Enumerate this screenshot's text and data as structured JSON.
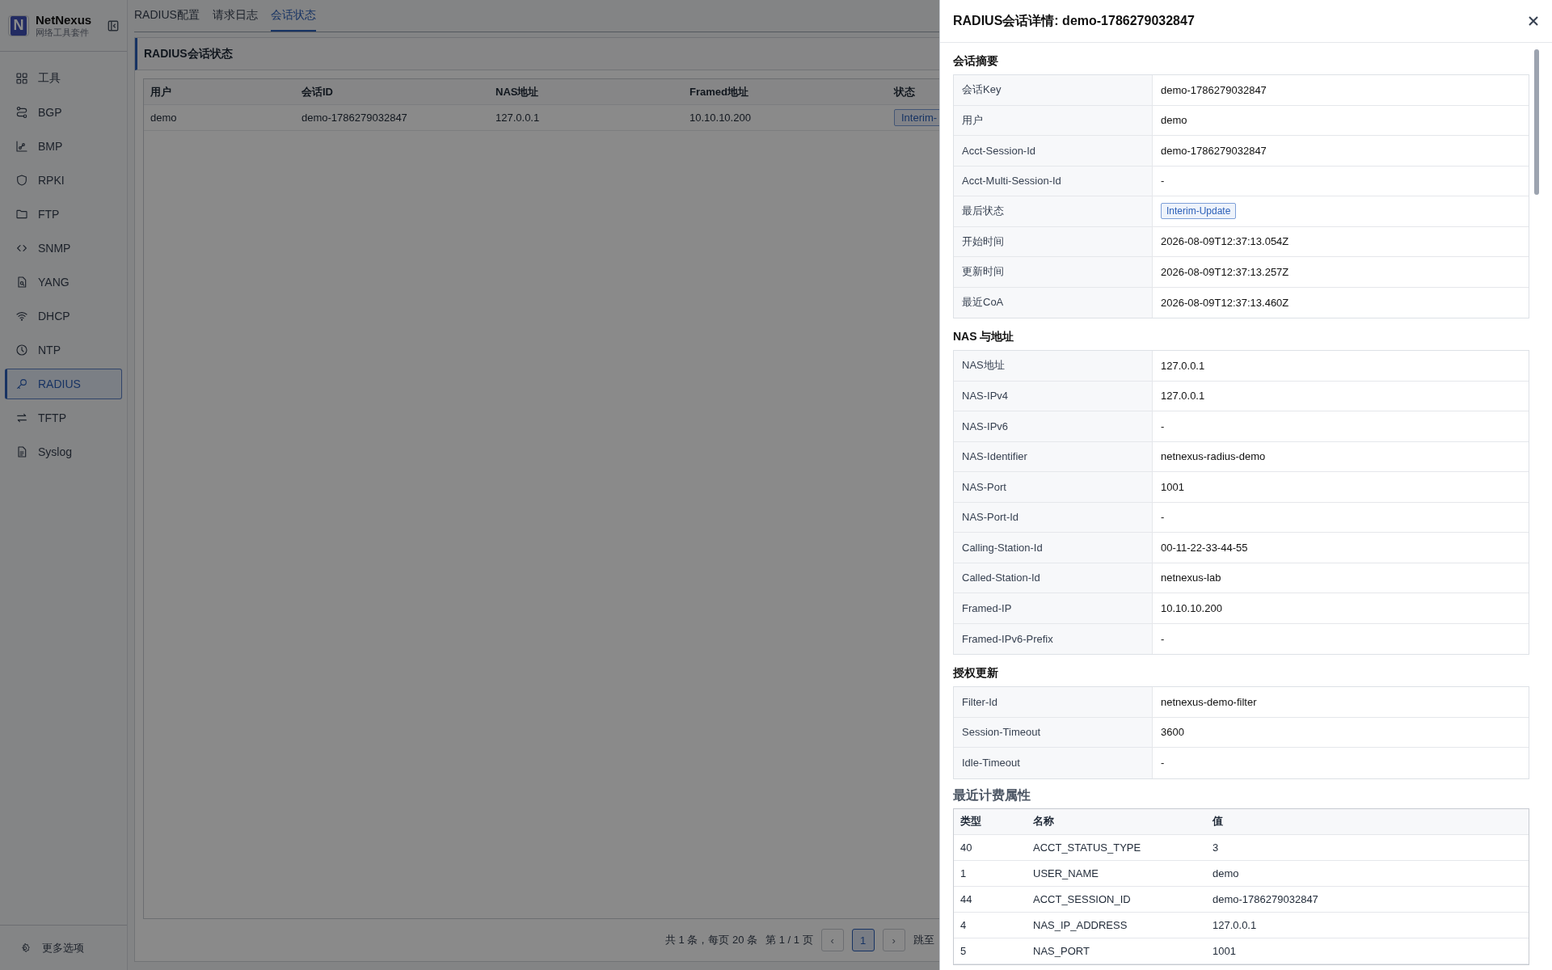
{
  "sidebar": {
    "brand": {
      "logo_letter": "N",
      "name": "NetNexus",
      "subtitle": "网络工具套件"
    },
    "items": [
      {
        "label": "工具",
        "selected": false
      },
      {
        "label": "BGP",
        "selected": false
      },
      {
        "label": "BMP",
        "selected": false
      },
      {
        "label": "RPKI",
        "selected": false
      },
      {
        "label": "FTP",
        "selected": false
      },
      {
        "label": "SNMP",
        "selected": false
      },
      {
        "label": "YANG",
        "selected": false
      },
      {
        "label": "DHCP",
        "selected": false
      },
      {
        "label": "NTP",
        "selected": false
      },
      {
        "label": "RADIUS",
        "selected": true
      },
      {
        "label": "TFTP",
        "selected": false
      },
      {
        "label": "Syslog",
        "selected": false
      }
    ],
    "footer": {
      "label": "更多选项"
    }
  },
  "tabs": [
    {
      "label": "RADIUS配置",
      "selected": false
    },
    {
      "label": "请求日志",
      "selected": false
    },
    {
      "label": "会话状态",
      "selected": true
    }
  ],
  "panel": {
    "title": "RADIUS会话状态",
    "table": {
      "columns": [
        "用户",
        "会话ID",
        "NAS地址",
        "Framed地址",
        "状态"
      ],
      "rows": [
        {
          "cells": [
            "demo",
            "demo-1786279032847",
            "127.0.0.1",
            "10.10.10.200"
          ],
          "status": "Interim-"
        }
      ]
    },
    "pagination": {
      "summary": "共 1 条，每页 20 条",
      "page_info": "第 1 / 1 页",
      "prev": "‹",
      "pages": [
        {
          "label": "1",
          "selected": true
        }
      ],
      "next": "›",
      "jump_label": "跳至"
    }
  },
  "drawer": {
    "title": "RADIUS会话详情: demo-1786279032847",
    "sections": [
      {
        "title": "会话摘要",
        "kind": "kv",
        "rows": [
          {
            "key": "会话Key",
            "value": "demo-1786279032847"
          },
          {
            "key": "用户",
            "value": "demo"
          },
          {
            "key": "Acct-Session-Id",
            "value": "demo-1786279032847"
          },
          {
            "key": "Acct-Multi-Session-Id",
            "value": "-"
          },
          {
            "key": "最后状态",
            "value": "Interim-Update",
            "kind": "tag"
          },
          {
            "key": "开始时间",
            "value": "2026-08-09T12:37:13.054Z"
          },
          {
            "key": "更新时间",
            "value": "2026-08-09T12:37:13.257Z"
          },
          {
            "key": "最近CoA",
            "value": "2026-08-09T12:37:13.460Z"
          }
        ]
      },
      {
        "title": "NAS 与地址",
        "kind": "kv",
        "rows": [
          {
            "key": "NAS地址",
            "value": "127.0.0.1"
          },
          {
            "key": "NAS-IPv4",
            "value": "127.0.0.1"
          },
          {
            "key": "NAS-IPv6",
            "value": "-"
          },
          {
            "key": "NAS-Identifier",
            "value": "netnexus-radius-demo"
          },
          {
            "key": "NAS-Port",
            "value": "1001"
          },
          {
            "key": "NAS-Port-Id",
            "value": "-"
          },
          {
            "key": "Calling-Station-Id",
            "value": "00-11-22-33-44-55"
          },
          {
            "key": "Called-Station-Id",
            "value": "netnexus-lab"
          },
          {
            "key": "Framed-IP",
            "value": "10.10.10.200"
          },
          {
            "key": "Framed-IPv6-Prefix",
            "value": "-"
          }
        ]
      },
      {
        "title": "授权更新",
        "kind": "kv",
        "rows": [
          {
            "key": "Filter-Id",
            "value": "netnexus-demo-filter"
          },
          {
            "key": "Session-Timeout",
            "value": "3600"
          },
          {
            "key": "Idle-Timeout",
            "value": "-"
          }
        ]
      },
      {
        "title": "最近计费属性",
        "kind": "table",
        "columns": [
          "类型",
          "名称",
          "值"
        ],
        "rows": [
          [
            "40",
            "ACCT_STATUS_TYPE",
            "3"
          ],
          [
            "1",
            "USER_NAME",
            "demo"
          ],
          [
            "44",
            "ACCT_SESSION_ID",
            "demo-1786279032847"
          ],
          [
            "4",
            "NAS_IP_ADDRESS",
            "127.0.0.1"
          ],
          [
            "5",
            "NAS_PORT",
            "1001"
          ]
        ]
      }
    ]
  }
}
